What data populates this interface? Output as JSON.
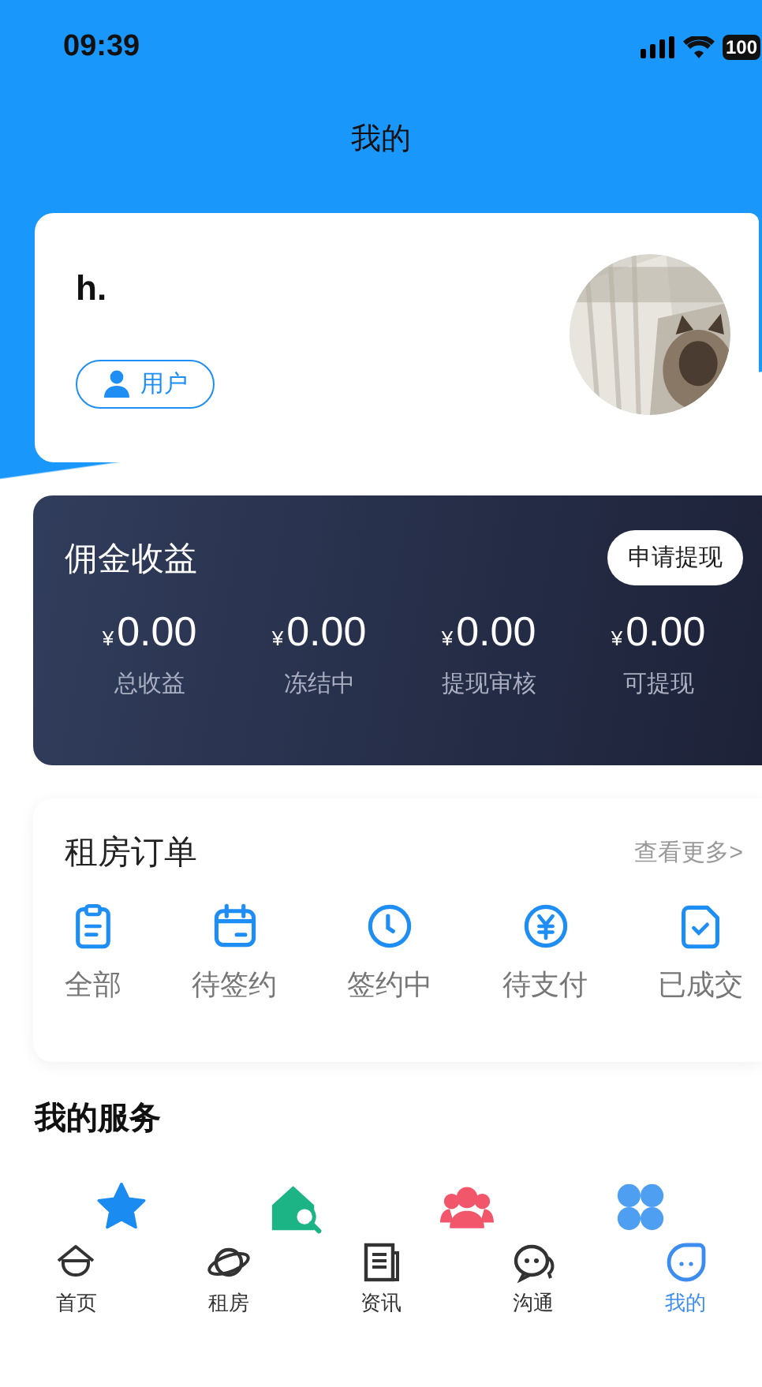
{
  "status_bar": {
    "time": "09:39",
    "battery": "100"
  },
  "title": "我的",
  "profile": {
    "name": "h.",
    "role": "用户"
  },
  "earnings": {
    "title": "佣金收益",
    "withdraw_button": "申请提现",
    "items": [
      {
        "currency": "¥",
        "amount": "0.00",
        "label": "总收益"
      },
      {
        "currency": "¥",
        "amount": "0.00",
        "label": "冻结中"
      },
      {
        "currency": "¥",
        "amount": "0.00",
        "label": "提现审核"
      },
      {
        "currency": "¥",
        "amount": "0.00",
        "label": "可提现"
      }
    ]
  },
  "orders": {
    "title": "租房订单",
    "more_link": "查看更多>",
    "items": [
      {
        "kind": "clipboard",
        "label": "全部"
      },
      {
        "kind": "calendar",
        "label": "待签约"
      },
      {
        "kind": "clock",
        "label": "签约中"
      },
      {
        "kind": "yen",
        "label": "待支付"
      },
      {
        "kind": "document",
        "label": "已成交"
      }
    ]
  },
  "services": {
    "title": "我的服务",
    "items": [
      {
        "kind": "star"
      },
      {
        "kind": "house-search"
      },
      {
        "kind": "people"
      },
      {
        "kind": "clover"
      }
    ]
  },
  "tab_bar": [
    {
      "kind": "home",
      "label": "首页",
      "selected": false
    },
    {
      "kind": "planet",
      "label": "租房",
      "selected": false
    },
    {
      "kind": "news",
      "label": "资讯",
      "selected": false
    },
    {
      "kind": "chat",
      "label": "沟通",
      "selected": false
    },
    {
      "kind": "me",
      "label": "我的",
      "selected": true
    }
  ]
}
